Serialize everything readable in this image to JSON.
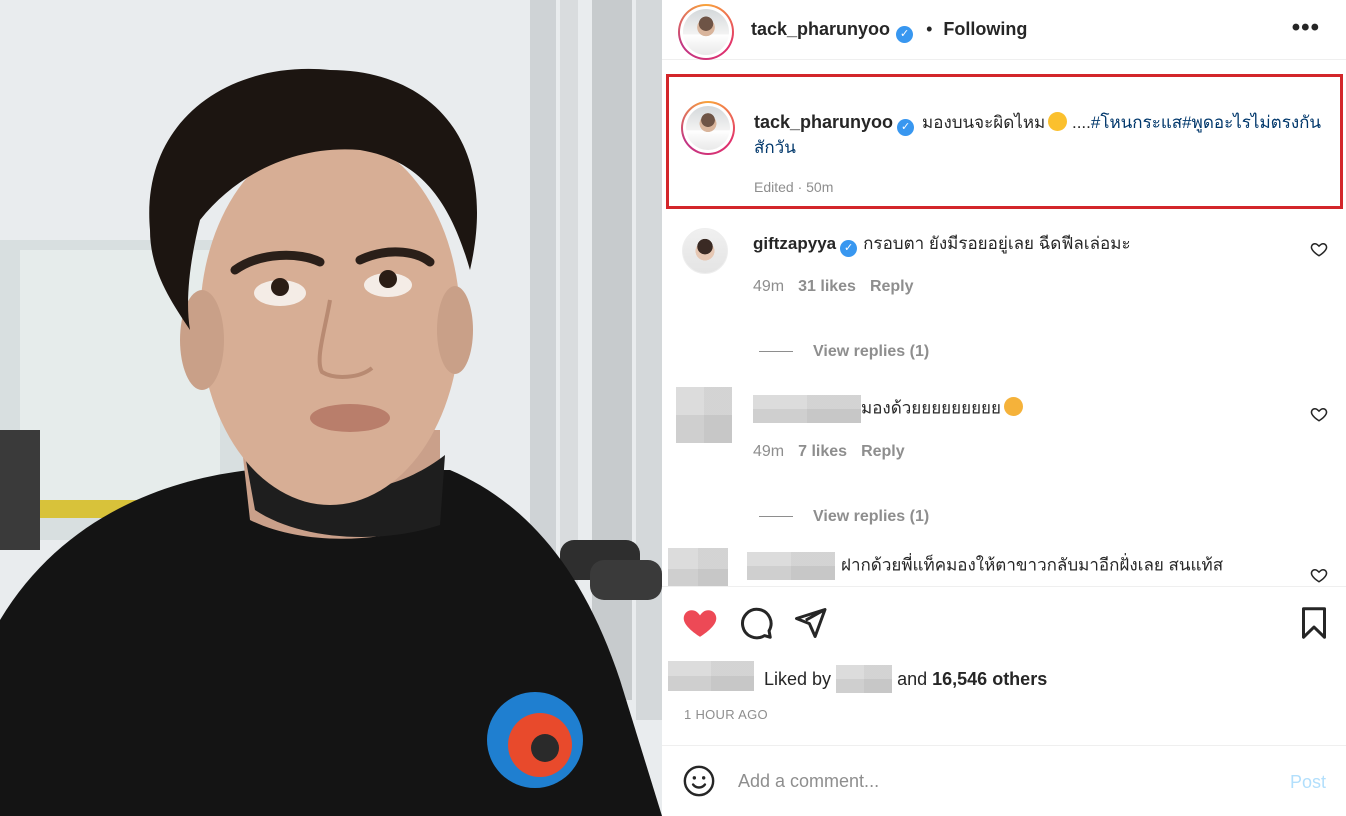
{
  "post": {
    "author": "tack_pharunyoo",
    "verified_mark": "✓",
    "follow_separator": "•",
    "follow_status": "Following",
    "more_label": "•••"
  },
  "caption": {
    "username": "tack_pharunyoo",
    "text": "มองบนจะผิดไหม",
    "ellipsis": "....",
    "hashtags": "#โหนกระแส#พูดอะไรไม่ตรงกันสักวัน",
    "meta": "Edited · 50m"
  },
  "comments": [
    {
      "username": "giftzapyya",
      "text": "กรอบตา ยังมีรอยอยู่เลย ฉีดฟีลเล่อมะ",
      "time": "49m",
      "likes": "31 likes",
      "reply_label": "Reply",
      "view_replies": "View replies (1)"
    },
    {
      "username": "",
      "text": "มองด้วยยยยยยยยย",
      "time": "49m",
      "likes": "7 likes",
      "reply_label": "Reply",
      "view_replies": "View replies (1)"
    },
    {
      "username": "",
      "text": "ฝากด้วยพี่แท็คมองให้ตาขาวกลับมาอีกฝั่งเลย สนแท้ส"
    }
  ],
  "likes": {
    "prefix": "Liked by",
    "middle": "and",
    "count_text": "16,546 others"
  },
  "time_ago": "1 HOUR AGO",
  "add_comment": {
    "placeholder": "Add a comment...",
    "post_label": "Post"
  },
  "colors": {
    "like_red": "#ed4956",
    "link_blue": "#00376b",
    "verified_blue": "#3897f0",
    "highlight_border": "#d3262a",
    "post_disabled": "#b2dffc"
  },
  "icons": [
    "heart-icon",
    "comment-icon",
    "share-icon",
    "bookmark-icon",
    "more-icon",
    "smile-icon",
    "verified-badge-icon"
  ]
}
